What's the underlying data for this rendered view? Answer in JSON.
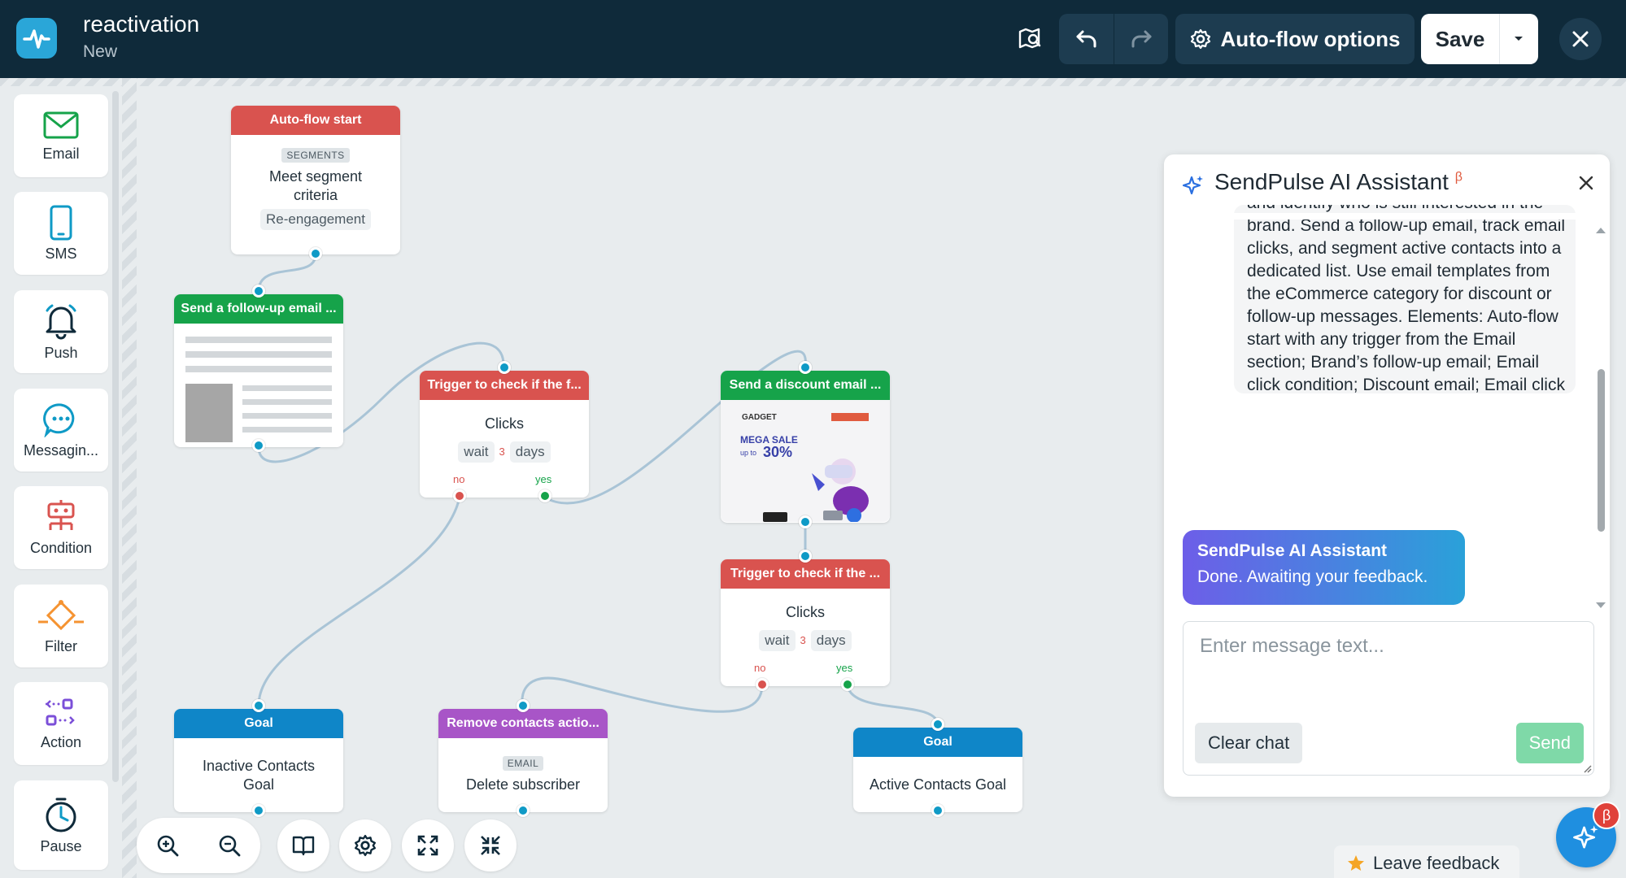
{
  "header": {
    "title": "reactivation",
    "subtitle": "New",
    "auto_flow_options_label": "Auto-flow options",
    "save_label": "Save"
  },
  "sidebar": {
    "items": [
      {
        "label": "Email",
        "icon": "envelope-icon"
      },
      {
        "label": "SMS",
        "icon": "phone-icon"
      },
      {
        "label": "Push",
        "icon": "bell-icon"
      },
      {
        "label": "Messagin...",
        "icon": "chat-bubble-icon"
      },
      {
        "label": "Condition",
        "icon": "condition-icon"
      },
      {
        "label": "Filter",
        "icon": "filter-icon"
      },
      {
        "label": "Action",
        "icon": "action-icon"
      },
      {
        "label": "Pause",
        "icon": "timer-icon"
      }
    ]
  },
  "flow": {
    "start": {
      "header": "Auto-flow start",
      "tag": "SEGMENTS",
      "text": "Meet segment criteria",
      "pill": "Re-engagement"
    },
    "email1": {
      "header": "Send a follow-up email ..."
    },
    "trigger1": {
      "header": "Trigger to check if the f...",
      "text": "Clicks",
      "wait": "wait",
      "num": "3",
      "days": "days",
      "no": "no",
      "yes": "yes"
    },
    "email2": {
      "header": "Send a discount email ...",
      "thumb_brand": "GADGET",
      "thumb_line1": "MEGA SALE",
      "thumb_line2": "up to",
      "thumb_pct": "30%"
    },
    "trigger2": {
      "header": "Trigger to check if the ...",
      "text": "Clicks",
      "wait": "wait",
      "num": "3",
      "days": "days",
      "no": "no",
      "yes": "yes"
    },
    "goal_inactive": {
      "header": "Goal",
      "text": "Inactive Contacts Goal"
    },
    "remove": {
      "header": "Remove contacts actio...",
      "tag": "EMAIL",
      "text": "Delete subscriber"
    },
    "goal_active": {
      "header": "Goal",
      "text": "Active Contacts Goal"
    }
  },
  "ai_panel": {
    "title": "SendPulse AI Assistant",
    "beta": "β",
    "message": "and identify who is still interested in the brand. Send a follow-up email, track email clicks, and segment active contacts into a dedicated list. Use email templates from the eCommerce category for discount or follow-up messages. Elements: Auto-flow start with any trigger from the Email section; Brand’s follow-up email; Email click condition; Discount email; Email click condition; Remove contacts action; Inactive contacts goal; Active contacts goal.",
    "assistant_name": "SendPulse AI Assistant",
    "assistant_text": "Done. Awaiting your feedback.",
    "input_placeholder": "Enter message text...",
    "clear_label": "Clear chat",
    "send_label": "Send"
  },
  "fab_badge": "β",
  "feedback_label": "Leave feedback",
  "colors": {
    "header_bg": "#0f2a3a",
    "accent": "#0f9ac6",
    "start_red": "#d9534f",
    "email_green": "#16a34a",
    "goal_blue": "#0f86c8",
    "action_purple": "#a855c7"
  }
}
